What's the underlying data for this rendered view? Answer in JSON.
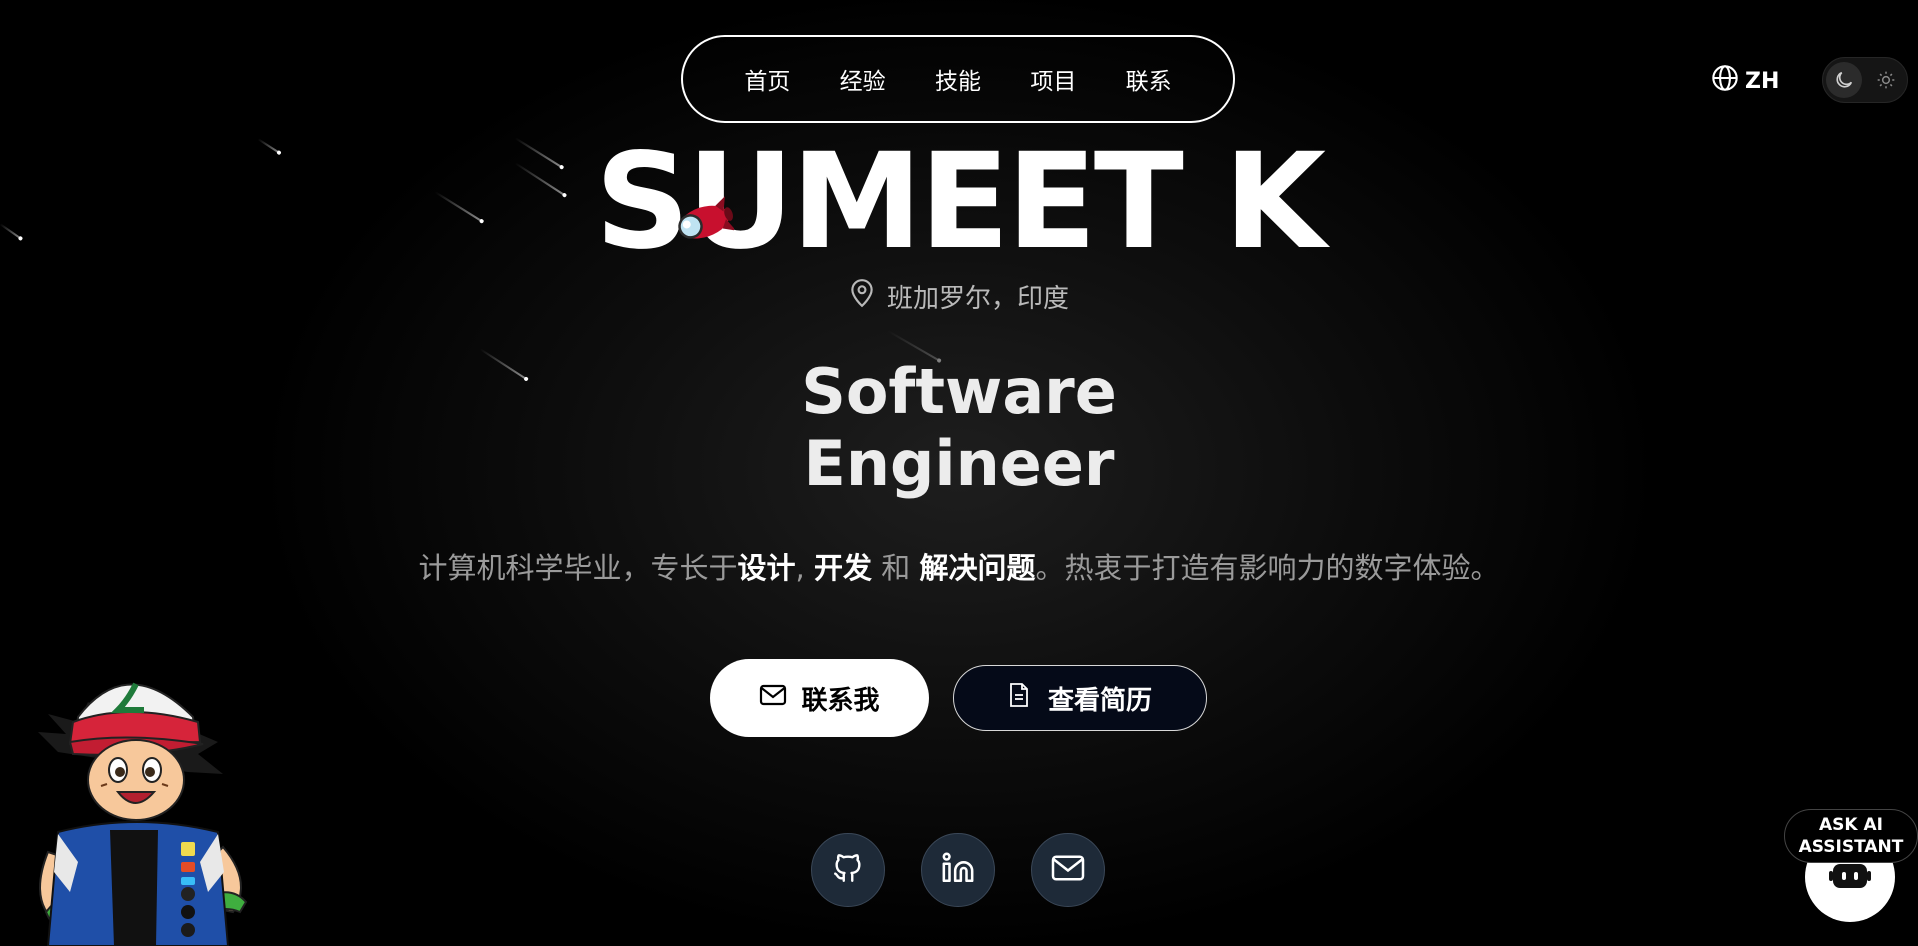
{
  "nav": {
    "items": [
      "首页",
      "经验",
      "技能",
      "项目",
      "联系"
    ]
  },
  "language": {
    "label": "ZH",
    "icon": "globe-icon"
  },
  "theme": {
    "active": "dark",
    "icons": [
      "moon-icon",
      "sun-icon"
    ]
  },
  "hero": {
    "name": "SUMEET K",
    "location": "班加罗尔，印度",
    "role_line1": "Software",
    "role_line2": "Engineer",
    "tagline": {
      "part1": "计算机科学毕业，专长于",
      "design": "设计",
      "sep1": ", ",
      "develop": "开发",
      "and": " 和 ",
      "solve": "解决问题",
      "part2": "。热衷于打造有影响力的数字体验。"
    }
  },
  "buttons": {
    "contact": "联系我",
    "resume": "查看简历"
  },
  "social": [
    "github-icon",
    "linkedin-icon",
    "mail-icon"
  ],
  "assistant": {
    "line1": "ASK AI",
    "line2": "ASSISTANT"
  },
  "colors": {
    "background": "#000000",
    "text": "#ffffff",
    "muted": "#9a9a9a",
    "social_bg": "#1e2a38",
    "resume_bg": "#050a18"
  }
}
